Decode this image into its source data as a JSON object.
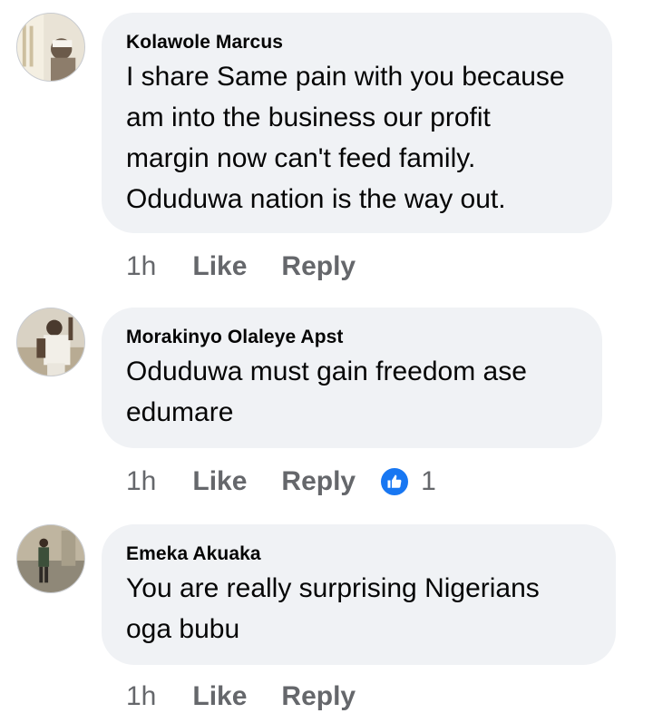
{
  "comments": [
    {
      "author": "Kolawole Marcus",
      "text": "I share Same pain with you because\nam into the business our profit\nmargin now can't feed family.\nOduduwa nation is the way out.",
      "time": "1h",
      "like_label": "Like",
      "reply_label": "Reply",
      "avatar_icon": "avatar-photo"
    },
    {
      "author": "Morakinyo Olaleye Apst",
      "text": "Oduduwa must gain freedom ase\nedumare",
      "time": "1h",
      "like_label": "Like",
      "reply_label": "Reply",
      "reaction_icon": "thumbs-up-icon",
      "reaction_count": "1",
      "avatar_icon": "avatar-photo"
    },
    {
      "author": "Emeka Akuaka",
      "text": "You are really surprising Nigerians\noga bubu",
      "time": "1h",
      "like_label": "Like",
      "reply_label": "Reply",
      "avatar_icon": "avatar-photo"
    }
  ],
  "colors": {
    "bubble": "#f0f2f5",
    "text": "#050505",
    "meta": "#65676b",
    "like_blue": "#1877f2"
  }
}
